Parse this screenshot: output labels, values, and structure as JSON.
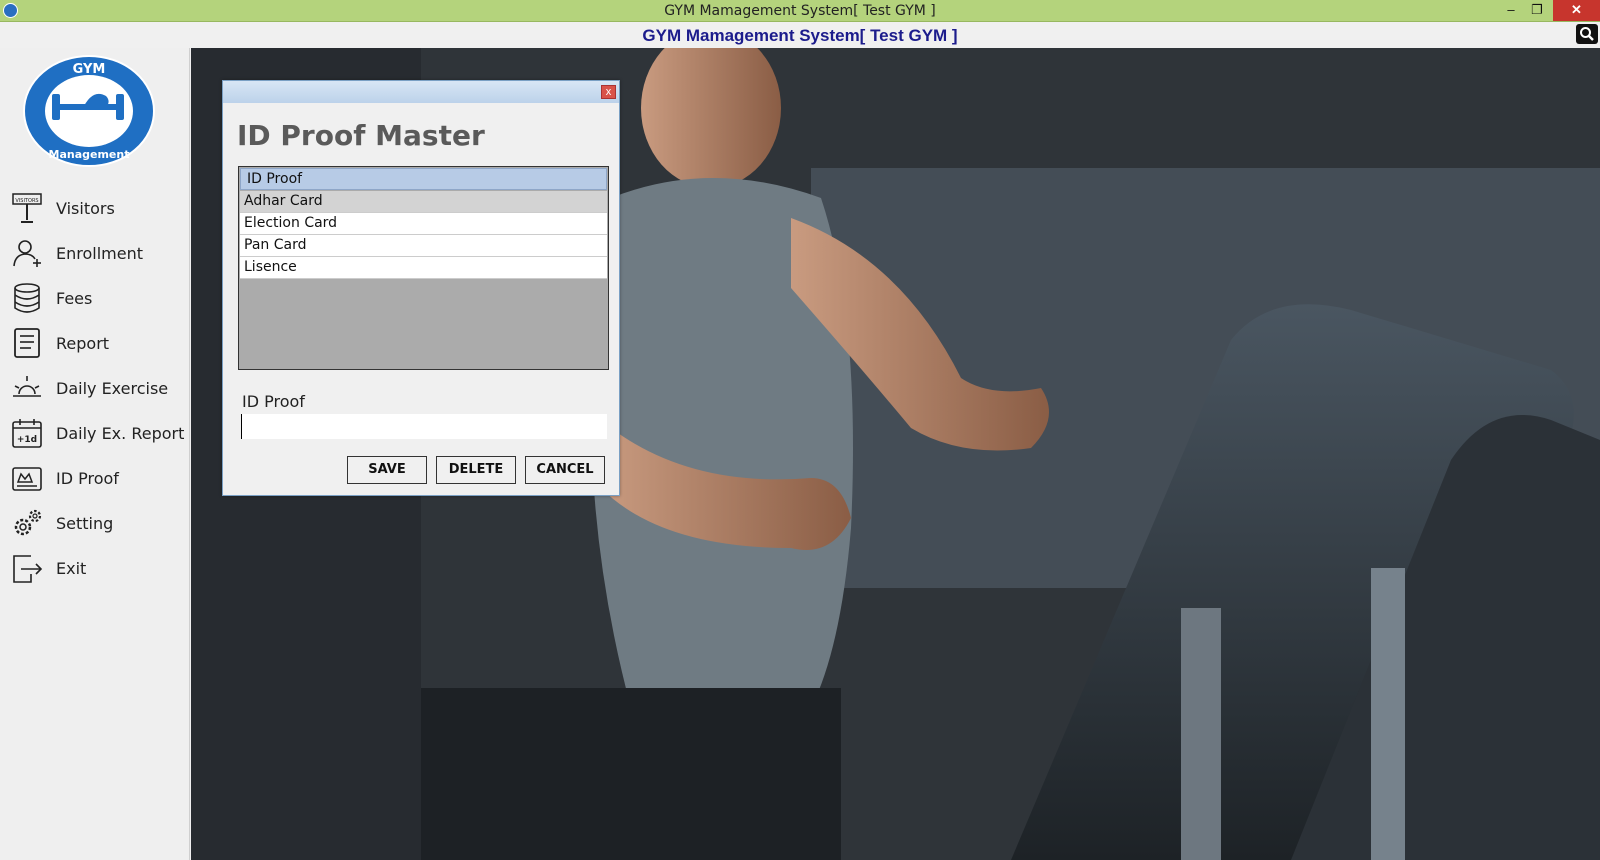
{
  "window": {
    "title": "GYM Mamagement System[ Test GYM ]"
  },
  "header": {
    "title": "GYM Mamagement System[ Test GYM ]"
  },
  "logo": {
    "top_text": "GYM",
    "bottom_text": "Management"
  },
  "sidebar": {
    "items": [
      {
        "label": "Visitors",
        "icon": "visitors-icon"
      },
      {
        "label": "Enrollment",
        "icon": "user-add-icon"
      },
      {
        "label": "Fees",
        "icon": "coins-icon"
      },
      {
        "label": "Report",
        "icon": "report-icon"
      },
      {
        "label": "Daily Exercise",
        "icon": "sun-icon"
      },
      {
        "label": "Daily Ex. Report",
        "icon": "calendar-icon"
      },
      {
        "label": "ID Proof",
        "icon": "id-card-icon"
      },
      {
        "label": "Setting",
        "icon": "gear-icon"
      },
      {
        "label": "Exit",
        "icon": "exit-icon"
      }
    ]
  },
  "dialog": {
    "heading": "ID Proof Master",
    "grid": {
      "column": "ID Proof",
      "rows": [
        "Adhar Card",
        "Election Card",
        "Pan Card",
        "Lisence"
      ]
    },
    "field_label": "ID Proof",
    "field_value": "",
    "buttons": {
      "save": "SAVE",
      "delete": "DELETE",
      "cancel": "CANCEL"
    },
    "close": "x"
  },
  "colors": {
    "titlebar": "#b4d37c",
    "header_text": "#1c1c8c",
    "logo_blue": "#1f6fc3"
  }
}
